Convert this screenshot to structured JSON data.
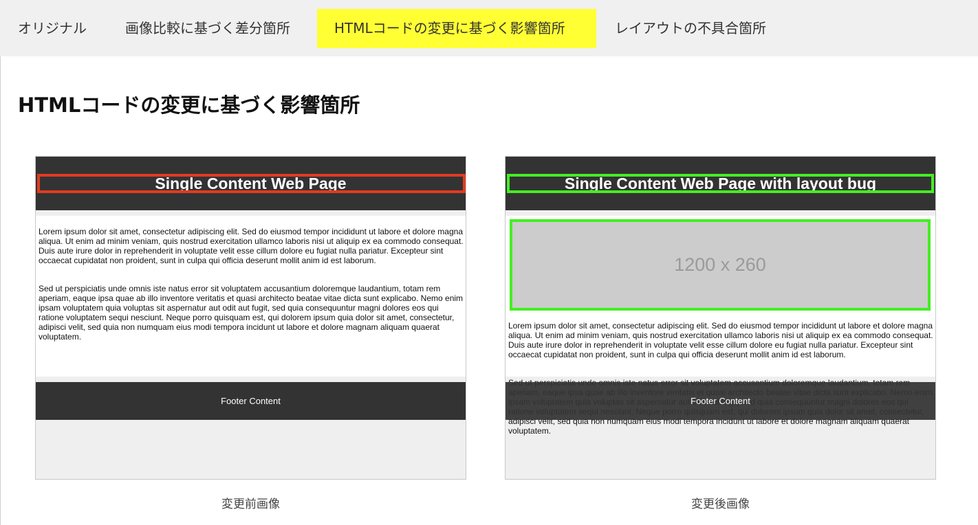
{
  "tabs": [
    {
      "label": "オリジナル",
      "active": false
    },
    {
      "label": "画像比較に基づく差分箇所",
      "active": false
    },
    {
      "label": "HTMLコードの変更に基づく影響箇所",
      "active": true
    },
    {
      "label": "レイアウトの不具合箇所",
      "active": false
    }
  ],
  "page_title": "HTMLコードの変更に基づく影響箇所",
  "before": {
    "site_title": "Single Content Web Page",
    "paragraph1": "Lorem ipsum dolor sit amet, consectetur adipiscing elit. Sed do eiusmod tempor incididunt ut labore et dolore magna aliqua. Ut enim ad minim veniam, quis nostrud exercitation ullamco laboris nisi ut aliquip ex ea commodo consequat. Duis aute irure dolor in reprehenderit in voluptate velit esse cillum dolore eu fugiat nulla pariatur. Excepteur sint occaecat cupidatat non proident, sunt in culpa qui officia deserunt mollit anim id est laborum.",
    "paragraph2": "Sed ut perspiciatis unde omnis iste natus error sit voluptatem accusantium doloremque laudantium, totam rem aperiam, eaque ipsa quae ab illo inventore veritatis et quasi architecto beatae vitae dicta sunt explicabo. Nemo enim ipsam voluptatem quia voluptas sit aspernatur aut odit aut fugit, sed quia consequuntur magni dolores eos qui ratione voluptatem sequi nesciunt. Neque porro quisquam est, qui dolorem ipsum quia dolor sit amet, consectetur, adipisci velit, sed quia non numquam eius modi tempora incidunt ut labore et dolore magnam aliquam quaerat voluptatem.",
    "footer": "Footer Content",
    "caption": "変更前画像"
  },
  "after": {
    "site_title": "Single Content Web Page with layout bug",
    "image_placeholder": "1200 x 260",
    "paragraph1": "Lorem ipsum dolor sit amet, consectetur adipiscing elit. Sed do eiusmod tempor incididunt ut labore et dolore magna aliqua. Ut enim ad minim veniam, quis nostrud exercitation ullamco laboris nisi ut aliquip ex ea commodo consequat. Duis aute irure dolor in reprehenderit in voluptate velit esse cillum dolore eu fugiat nulla pariatur. Excepteur sint occaecat cupidatat non proident, sunt in culpa qui officia deserunt mollit anim id est laborum.",
    "paragraph2": "Sed ut perspiciatis unde omnis iste natus error sit voluptatem accusantium doloremque laudantium, totam rem aperiam, eaque ipsa quae ab illo inventore veritatis et quasi architecto beatae vitae dicta sunt explicabo. Nemo enim ipsam voluptatem quia voluptas sit aspernatur aut odit aut fugit, sed quia consequuntur magni dolores eos qui ratione voluptatem sequi nesciunt. Neque porro quisquam est, qui dolorem ipsum quia dolor sit amet, consectetur, adipisci velit, sed quia non numquam eius modi tempora incidunt ut labore et dolore magnam aliquam quaerat voluptatem.",
    "footer": "Footer Content",
    "caption": "変更後画像"
  },
  "colors": {
    "active_tab": "#ffff33",
    "removed_highlight": "#e23b20",
    "added_highlight": "#44ee22"
  }
}
